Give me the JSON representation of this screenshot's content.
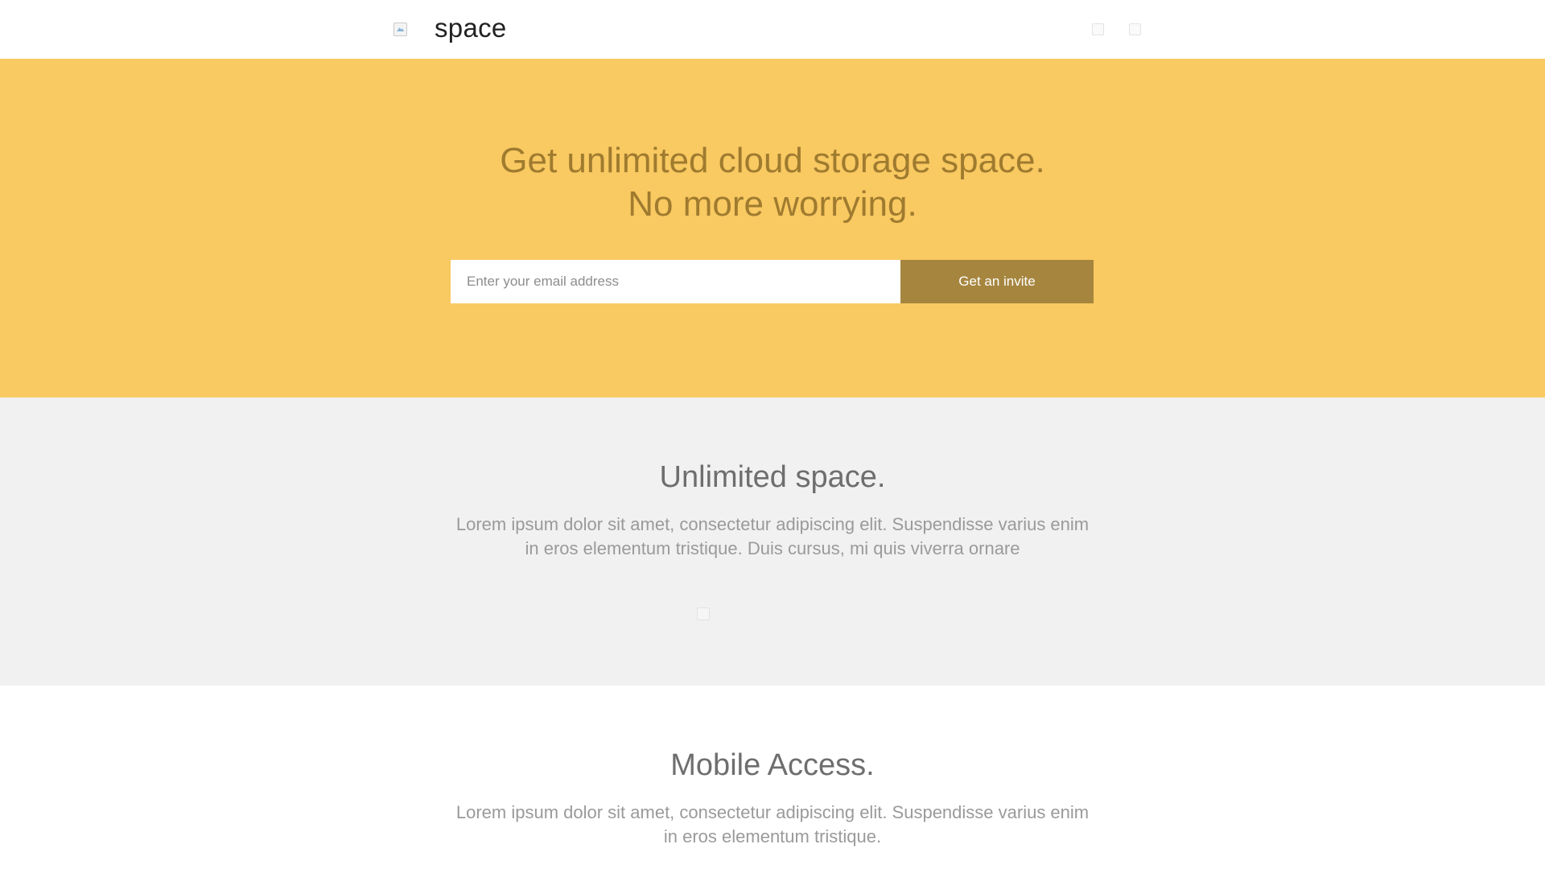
{
  "header": {
    "brand": "space",
    "logo_icon": "logo-image-icon",
    "nav_icons": [
      "social-icon-1",
      "social-icon-2"
    ]
  },
  "hero": {
    "title_line1": "Get unlimited cloud storage space.",
    "title_line2": "No more worrying.",
    "email_placeholder": "Enter your email address",
    "email_value": "",
    "button_label": "Get an invite",
    "background_color": "#f9c962",
    "button_color": "#a6863f"
  },
  "features": [
    {
      "title": "Unlimited space.",
      "text_line1": "Lorem ipsum dolor sit amet, consectetur adipiscing elit. Suspendisse varius enim",
      "text_line2": "in eros elementum tristique. Duis cursus, mi quis viverra ornare",
      "image_icon": "feature-image-icon"
    },
    {
      "title": "Mobile Access.",
      "text_line1": "Lorem ipsum dolor sit amet, consectetur adipiscing elit. Suspendisse varius enim",
      "text_line2": "in eros elementum tristique."
    }
  ]
}
